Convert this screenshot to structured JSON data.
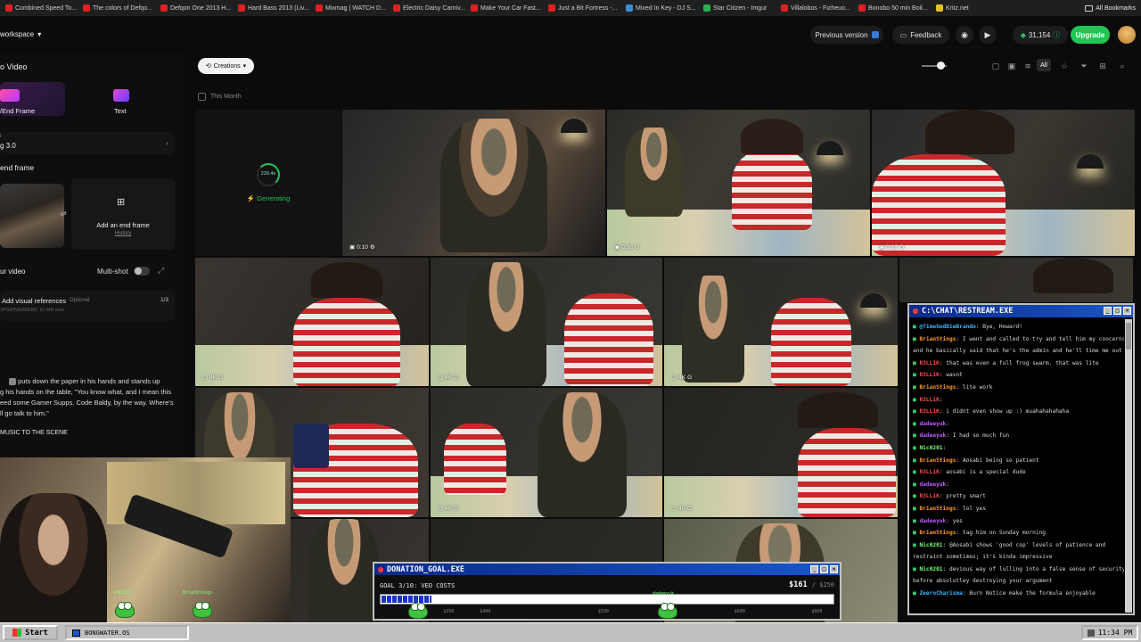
{
  "bookmarks": {
    "items": [
      {
        "label": "Combined Speed To...",
        "color": "#e02020"
      },
      {
        "label": "The colors of Defqo...",
        "color": "#e02020"
      },
      {
        "label": "Defqon One 2013 H...",
        "color": "#e02020"
      },
      {
        "label": "Hard Bass 2013 (Liv...",
        "color": "#e02020"
      },
      {
        "label": "Mixmag | WATCH D...",
        "color": "#e02020"
      },
      {
        "label": "Electric Daisy Carniv...",
        "color": "#e02020"
      },
      {
        "label": "Make Your Car Fast...",
        "color": "#e02020"
      },
      {
        "label": "Just a Bit Fortress -...",
        "color": "#e02020"
      },
      {
        "label": "Mixed In Key - DJ S...",
        "color": "#3a8fd8"
      },
      {
        "label": "Star Citizen - Imgur",
        "color": "#2ab04a"
      },
      {
        "label": "Villalobos - Fizheuo...",
        "color": "#e02020"
      },
      {
        "label": "Bonobo 50 min Boil...",
        "color": "#e02020"
      },
      {
        "label": "Kritz.net",
        "color": "#e8c020"
      }
    ],
    "all_bookmarks": "All Bookmarks"
  },
  "topbar": {
    "workspace": "workspace",
    "previous_version": "Previous version",
    "feedback": "Feedback",
    "credits": "31,154",
    "upgrade": "Upgrade"
  },
  "left": {
    "title": "o Video",
    "tab_frame": "/End Frame",
    "tab_text": "Text",
    "model_label": "l",
    "model": "g 3.0",
    "end_frame_title": "end frame",
    "add_end_frame": "Add an end frame",
    "history": "History",
    "your_video": "ur video",
    "multishot": "Multi-shot",
    "add_refs": "Add visual references",
    "optional": "Optional",
    "ref_count": "1/3",
    "ref_formats": "JPG/PNG/WEBP, 10 MB max",
    "prompt_1": "puts down the paper in his hands and stands up",
    "prompt_2": "g his hands on the table, \"You know what, and I mean this",
    "prompt_3": "eed some Gamer Supps. Code Baldy, by the way. Where's",
    "prompt_4": "ll go talk to him.\"",
    "music": "MUSIC TO THE SCENE"
  },
  "main": {
    "creations": "Creations",
    "this_month": "This Month",
    "all": "All",
    "generating": "Generating",
    "progress_label": "239.4s",
    "tiles": [
      {
        "badge": "0:10"
      },
      {
        "badge": "0:08"
      },
      {
        "badge": "0:12"
      },
      {
        "badge": "4K"
      },
      {
        "badge": "4K"
      },
      {
        "badge": "4K"
      },
      {
        "badge": "4K"
      },
      {
        "badge": "4K"
      }
    ]
  },
  "chat": {
    "title": "C:\\CHAT\\RESTREAM.EXE",
    "lines": [
      {
        "user": "@TimeGodDieBrando",
        "color": "#38b6ff",
        "msg": "Bye, Howard!"
      },
      {
        "user": "BrianStings",
        "color": "#ff9a2a",
        "msg": "I went and called to try and tell him my concerns"
      },
      {
        "user": "",
        "color": "#d8d8d8",
        "msg": "and he basically said that he's the admin and he'll time me out"
      },
      {
        "user": "R3LL1K",
        "color": "#ff4a4a",
        "msg": "that was even a full frog swarm. that was lite"
      },
      {
        "user": "R3LL1K",
        "color": "#ff4a4a",
        "msg": "wasnt"
      },
      {
        "user": "BrianStings",
        "color": "#ff9a2a",
        "msg": "lite work"
      },
      {
        "user": "R3LL1K",
        "color": "#ff4a4a",
        "msg": ""
      },
      {
        "user": "R3LL1K",
        "color": "#ff4a4a",
        "msg": "i didnt even show up :) muahahahahaha"
      },
      {
        "user": "dadeeyuk",
        "color": "#c25cff",
        "msg": ""
      },
      {
        "user": "dadeeyuk",
        "color": "#c25cff",
        "msg": "I had so much fun"
      },
      {
        "user": "Nic0201",
        "color": "#7dff7d",
        "msg": ""
      },
      {
        "user": "BrianStings",
        "color": "#ff9a2a",
        "msg": "Aosabi being so patient"
      },
      {
        "user": "R3LL1K",
        "color": "#ff4a4a",
        "msg": "aosabi is a special dude"
      },
      {
        "user": "dadeeyuk",
        "color": "#c25cff",
        "msg": ""
      },
      {
        "user": "R3LL1K",
        "color": "#ff4a4a",
        "msg": "pretty smart"
      },
      {
        "user": "BrianStings",
        "color": "#ff9a2a",
        "msg": "lol yes"
      },
      {
        "user": "dadeeyuk",
        "color": "#c25cff",
        "msg": "yes"
      },
      {
        "user": "BrianStings",
        "color": "#ff9a2a",
        "msg": "tag him on Sunday morning"
      },
      {
        "user": "Nic0201",
        "color": "#7dff7d",
        "msg": "@Aosabi shows 'good cop' levels of patience and"
      },
      {
        "user": "",
        "color": "#d8d8d8",
        "msg": "restraint sometimes; it's kinda impressive"
      },
      {
        "user": "Nic0201",
        "color": "#7dff7d",
        "msg": "devious way of lulling into a false sense of security;"
      },
      {
        "user": "",
        "color": "#d8d8d8",
        "msg": "before absolutley destroying your argument"
      },
      {
        "user": "ZeeroCharisma",
        "color": "#38b6ff",
        "msg": "Burn Notice make the formula enjoyable"
      }
    ]
  },
  "donation": {
    "title": "DONATION_GOAL.EXE",
    "goal": "GOAL 3/10: VEO COSTS",
    "amount": "$161",
    "max": "/ $250",
    "progress_fraction": 0.11,
    "ticks": [
      "$350",
      "$400",
      "$500",
      "$550",
      "$600",
      "$900"
    ]
  },
  "webcam": {
    "frog_1": "R3LL1K",
    "frog_2": "BrianStings",
    "frog_3": "dadeeyuk"
  },
  "taskbar": {
    "start": "Start",
    "task": "BONGWATER.OS",
    "clock": "11:34 PM"
  }
}
